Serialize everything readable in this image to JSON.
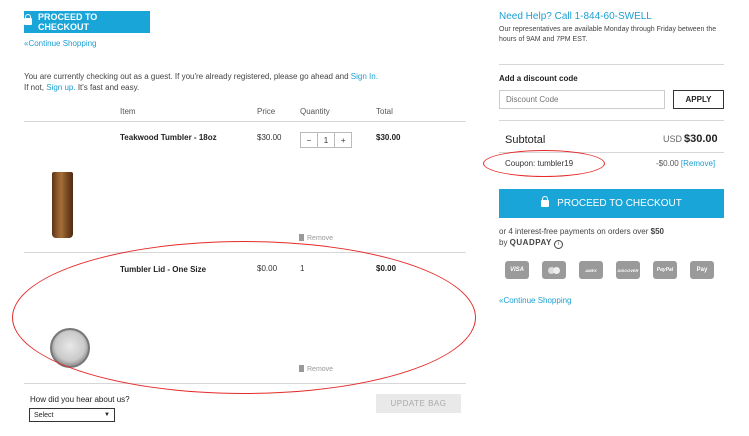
{
  "top": {
    "checkout_label": "PROCEED TO CHECKOUT",
    "continue_label": "Continue Shopping",
    "continue_prefix": "«"
  },
  "guest": {
    "line1_pre": "You are currently checking out as a guest. If you're already registered, please go ahead and ",
    "signin": "Sign In.",
    "line2_pre": "If not, ",
    "signup": "Sign up.",
    "line2_post": " It's fast and easy."
  },
  "table": {
    "headers": {
      "item": "Item",
      "price": "Price",
      "quantity": "Quantity",
      "total": "Total"
    },
    "rows": [
      {
        "name": "Teakwood Tumbler - 18oz",
        "price": "$30.00",
        "qty": "1",
        "total": "$30.00",
        "remove": "Remove",
        "minus": "−",
        "plus": "+"
      },
      {
        "name": "Tumbler Lid - One Size",
        "price": "$0.00",
        "qty": "1",
        "total": "$0.00",
        "remove": "Remove"
      }
    ]
  },
  "hear": {
    "label": "How did you hear about us?",
    "select_value": "Select"
  },
  "update_label": "UPDATE BAG",
  "help": {
    "title": "Need Help? Call 1-844-60-SWELL",
    "text": "Our representatives are available Monday through Friday between the hours of 9AM and 7PM EST."
  },
  "discount": {
    "label": "Add a discount code",
    "placeholder": "Discount Code",
    "apply": "APPLY"
  },
  "summary": {
    "subtotal_label": "Subtotal",
    "currency": "USD",
    "subtotal_value": "$30.00",
    "coupon_label": "Coupon: tumbler19",
    "coupon_value": "-$0.00",
    "coupon_remove": "[Remove]"
  },
  "checkout_big": "PROCEED TO CHECKOUT",
  "quadpay": {
    "text_pre": "or 4 interest-free payments on orders over ",
    "amount": "$50",
    "by": "by ",
    "brand": "QUADPAY",
    "info": "i"
  },
  "cards": [
    "VISA",
    "MC",
    "AMEX",
    "DISCOVER",
    "PayPal",
    "Pay"
  ],
  "continue_bottom": "Continue Shopping",
  "colors": {
    "accent": "#19a5d8",
    "annotation": "#e52b2b"
  }
}
